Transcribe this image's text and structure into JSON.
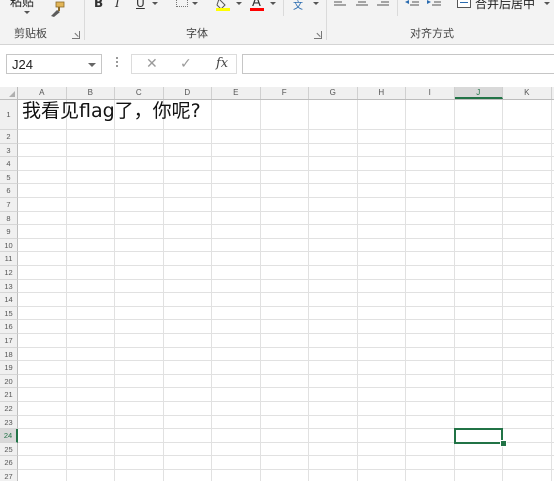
{
  "ribbon": {
    "clipboard": {
      "paste_label": "粘贴",
      "group_label": "剪贴板"
    },
    "font": {
      "bold": "B",
      "italic": "I",
      "underline": "U",
      "font_color_glyph": "A",
      "group_label": "字体",
      "highlight_color": "#ffff00",
      "font_color": "#ff0000"
    },
    "alignment": {
      "merge_label": "合并后居中",
      "wrap_glyph": "文",
      "group_label": "对齐方式"
    }
  },
  "formula_bar": {
    "name_box": "J24",
    "cancel_glyph": "✕",
    "enter_glyph": "✓",
    "fx_label": "fx",
    "formula": ""
  },
  "sheet": {
    "columns": [
      "A",
      "B",
      "C",
      "D",
      "E",
      "F",
      "G",
      "H",
      "I",
      "J",
      "K"
    ],
    "selected_column": "J",
    "rows": [
      "1",
      "2",
      "3",
      "4",
      "5",
      "6",
      "7",
      "8",
      "9",
      "10",
      "11",
      "12",
      "13",
      "14",
      "15",
      "16",
      "17",
      "18",
      "19",
      "20",
      "21",
      "22",
      "23",
      "24",
      "25",
      "26",
      "27"
    ],
    "selected_row": "24",
    "cell_a1": "我看见flag了，你呢?",
    "accent": "#217346"
  }
}
